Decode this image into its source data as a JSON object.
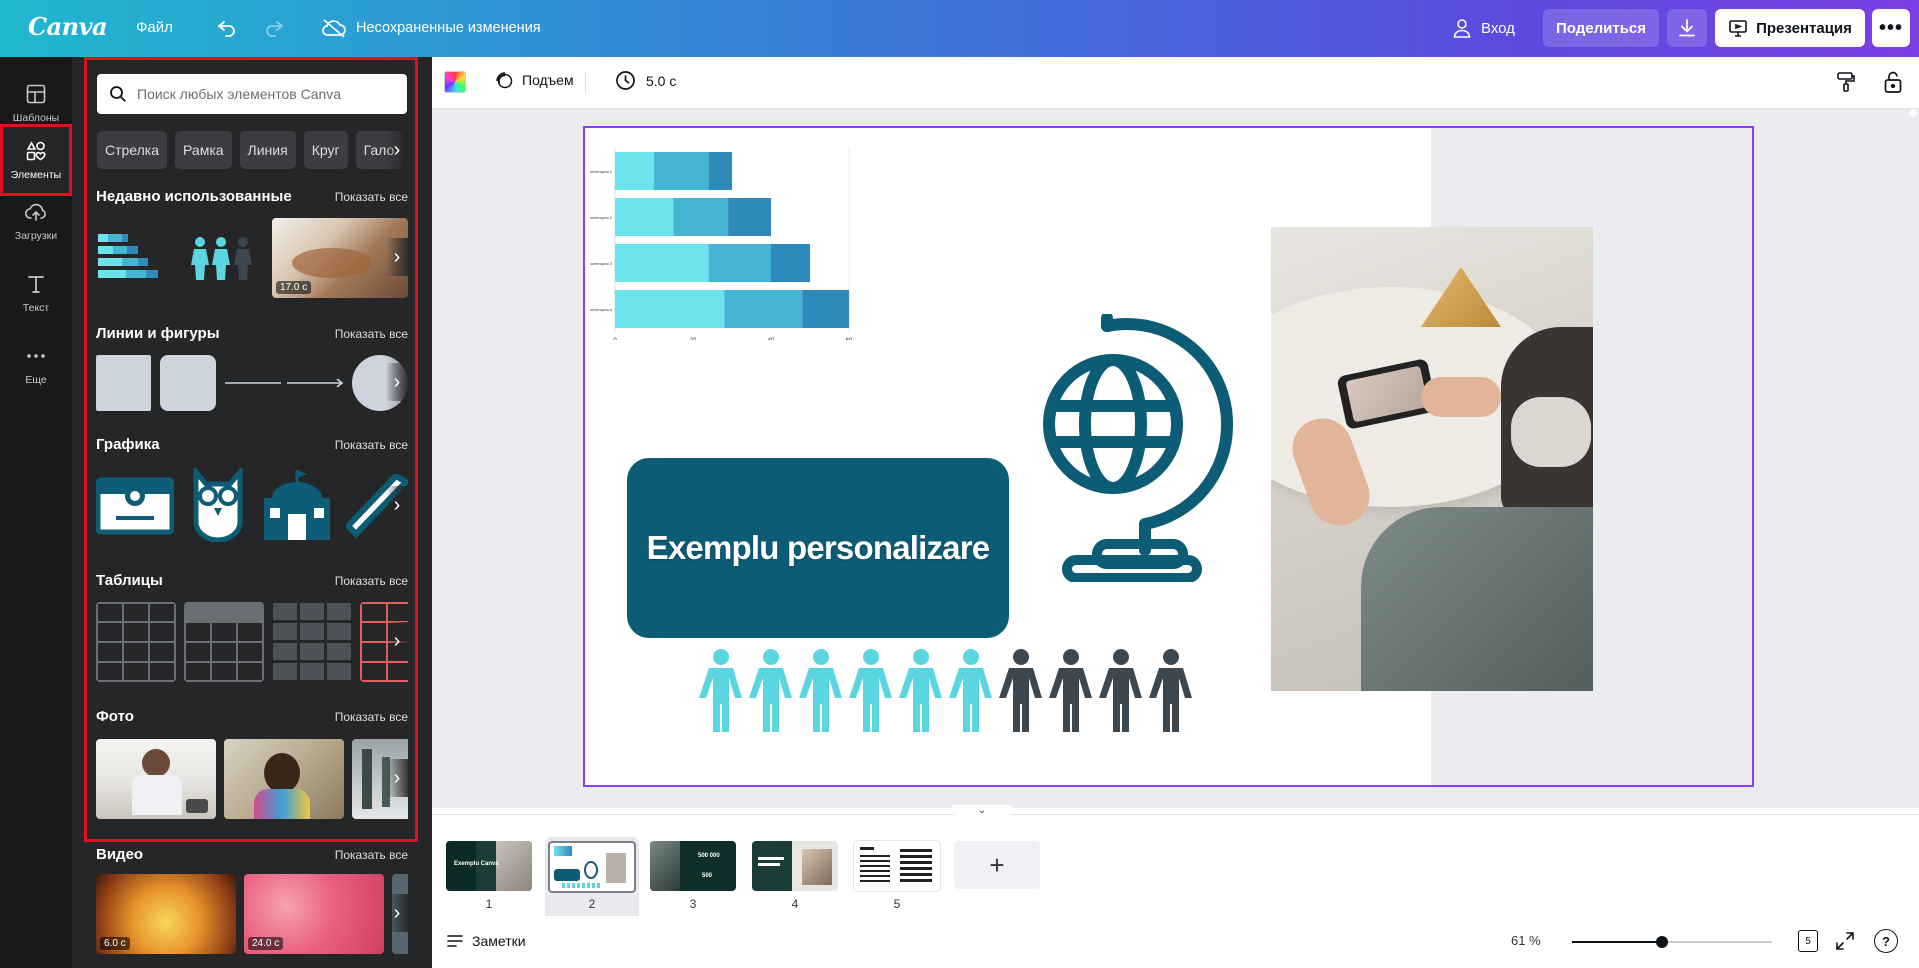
{
  "topbar": {
    "logo": "Canva",
    "file_menu": "Файл",
    "save_status": "Несохраненные изменения",
    "login": "Вход",
    "share": "Поделиться",
    "present": "Презентация",
    "more": "•••"
  },
  "rail": {
    "items": [
      {
        "label": "Шаблоны",
        "icon": "templates-icon"
      },
      {
        "label": "Элементы",
        "icon": "elements-icon",
        "active": true
      },
      {
        "label": "Загрузки",
        "icon": "upload-cloud-icon"
      },
      {
        "label": "Текст",
        "icon": "text-icon"
      },
      {
        "label": "Еще",
        "icon": "more-dots-icon"
      }
    ]
  },
  "panel": {
    "search_placeholder": "Поиск любых элементов Canva",
    "chips": [
      "Стрелка",
      "Рамка",
      "Линия",
      "Круг",
      "Гало"
    ],
    "show_all": "Показать все",
    "sections": {
      "recent": "Недавно использованные",
      "lines": "Линии и фигуры",
      "graphics": "Графика",
      "tables": "Таблицы",
      "photos": "Фото",
      "video": "Видео"
    },
    "recent_duration": "17.0 с",
    "video_durations": [
      "6.0 с",
      "24.0 с"
    ]
  },
  "toolbar": {
    "animation": "Подъем",
    "duration": "5.0 с"
  },
  "canvas": {
    "title_box": "Exemplu personalizare",
    "colors": {
      "teal_dark": "#0d5c75",
      "cyan": "#5bd6e0",
      "gray": "#3d4750",
      "accent": "#8b3dff"
    },
    "people_cyan_count": 6,
    "people_gray_count": 4
  },
  "chart_data": {
    "type": "bar",
    "orientation": "horizontal",
    "stacked": true,
    "categories": [
      "категория 1",
      "категория 2",
      "категория 3",
      "категория 4"
    ],
    "series": [
      {
        "values": [
          10,
          15,
          24,
          28
        ],
        "color": "#6ae3ea"
      },
      {
        "values": [
          14,
          14,
          16,
          20
        ],
        "color": "#45b5d4"
      },
      {
        "values": [
          6,
          11,
          10,
          12
        ],
        "color": "#2f8abb"
      }
    ],
    "xticks": [
      "0",
      "20",
      "40",
      "60"
    ],
    "xlim": [
      0,
      60
    ]
  },
  "pages": {
    "numbers": [
      "1",
      "2",
      "3",
      "4",
      "5"
    ],
    "active": 2,
    "thumb3_texts": [
      "500 000",
      "500"
    ],
    "thumb1_text": "Exemplu Canva",
    "add_page": "+"
  },
  "footer": {
    "notes": "Заметки",
    "zoom": "61 %",
    "zoom_value": 0.45,
    "page_count": "5",
    "help": "?"
  }
}
